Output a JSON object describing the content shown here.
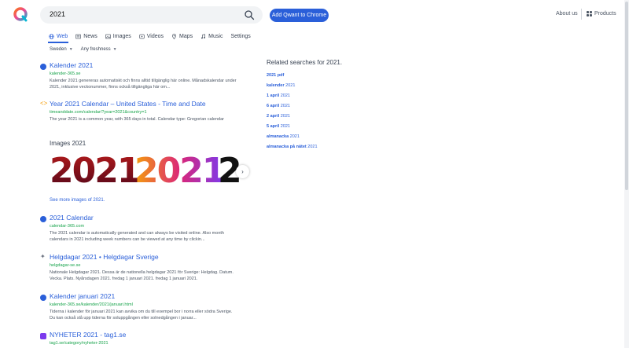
{
  "header": {
    "search_value": "2021",
    "cta_label": "Add Qwant to Chrome",
    "about_label": "About us",
    "products_label": "Products"
  },
  "tabs": [
    {
      "label": "Web",
      "icon": "globe-icon"
    },
    {
      "label": "News",
      "icon": "news-icon"
    },
    {
      "label": "Images",
      "icon": "image-icon"
    },
    {
      "label": "Videos",
      "icon": "video-icon"
    },
    {
      "label": "Maps",
      "icon": "map-pin-icon"
    },
    {
      "label": "Music",
      "icon": "music-icon"
    },
    {
      "label": "Settings",
      "icon": ""
    }
  ],
  "filters": {
    "region": "Sweden",
    "freshness": "Any freshness"
  },
  "results": [
    {
      "title": "Kalender 2021",
      "url": "kalender-365.se",
      "snippet": "Kalender 2021 genereras automatiskt och finns alltid tillgänglig här online. Månadskalendar under 2021, inklusive veckonummer, finns också tillgängliga här om..."
    },
    {
      "title": "Year 2021 Calendar – United States - Time and Date",
      "url": "timeanddate.com/calendar/?year=2021&country=1",
      "snippet": "The year 2021 is a common year, with 365 days in total. Calendar type: Gregorian calendar"
    },
    {
      "title": "2021 Calendar",
      "url": "calendar-365.com",
      "snippet": "The 2021 calendar is automatically generated and can always be visited online. Also month calendars in 2021 including week numbers can be viewed at any time by clickin..."
    },
    {
      "title": "Helgdagar 2021 • Helgdagar Sverige",
      "url": "helgdagar-se.se",
      "snippet": "Nationale Helgdagar 2021. Dessa är de nationella helgdagar 2021 för Sverige: Helgdag. Datum. Vecka. Plats. Nyårsdagen 2021. fredag 1 januari 2021. fredag 1 januari 2021."
    },
    {
      "title": "Kalender januari 2021",
      "url": "kalender-365.se/kalender/2021/januari.html",
      "snippet": "Tiderna i kalender för januari 2021 kan avvika om du till exempel bor i norra eller södra Sverige. Du kan också slå upp tiderna för soluppgången eller solnedgången i januar..."
    },
    {
      "title": "NYHETER 2021 - tag1.se",
      "url": "tag1.se/category/nyheter-2021",
      "snippet": ""
    }
  ],
  "images": {
    "heading": "Images 2021",
    "tiles": [
      "2021",
      "2021",
      "2"
    ],
    "see_more": "See more images of 2021."
  },
  "related": {
    "title": "Related searches for 2021.",
    "items": [
      {
        "bold": "2021 pdf",
        "rest": ""
      },
      {
        "bold": "kalender",
        "rest": " 2021"
      },
      {
        "bold": "1 april",
        "rest": " 2021"
      },
      {
        "bold": "6 april",
        "rest": " 2021"
      },
      {
        "bold": "2 april",
        "rest": " 2021"
      },
      {
        "bold": "5 april",
        "rest": " 2021"
      },
      {
        "bold": "almanacka",
        "rest": " 2021"
      },
      {
        "bold": "almanacka på nätet",
        "rest": " 2021"
      }
    ]
  },
  "colors": {
    "accent": "#2a5fd9",
    "url_green": "#16a34a"
  }
}
